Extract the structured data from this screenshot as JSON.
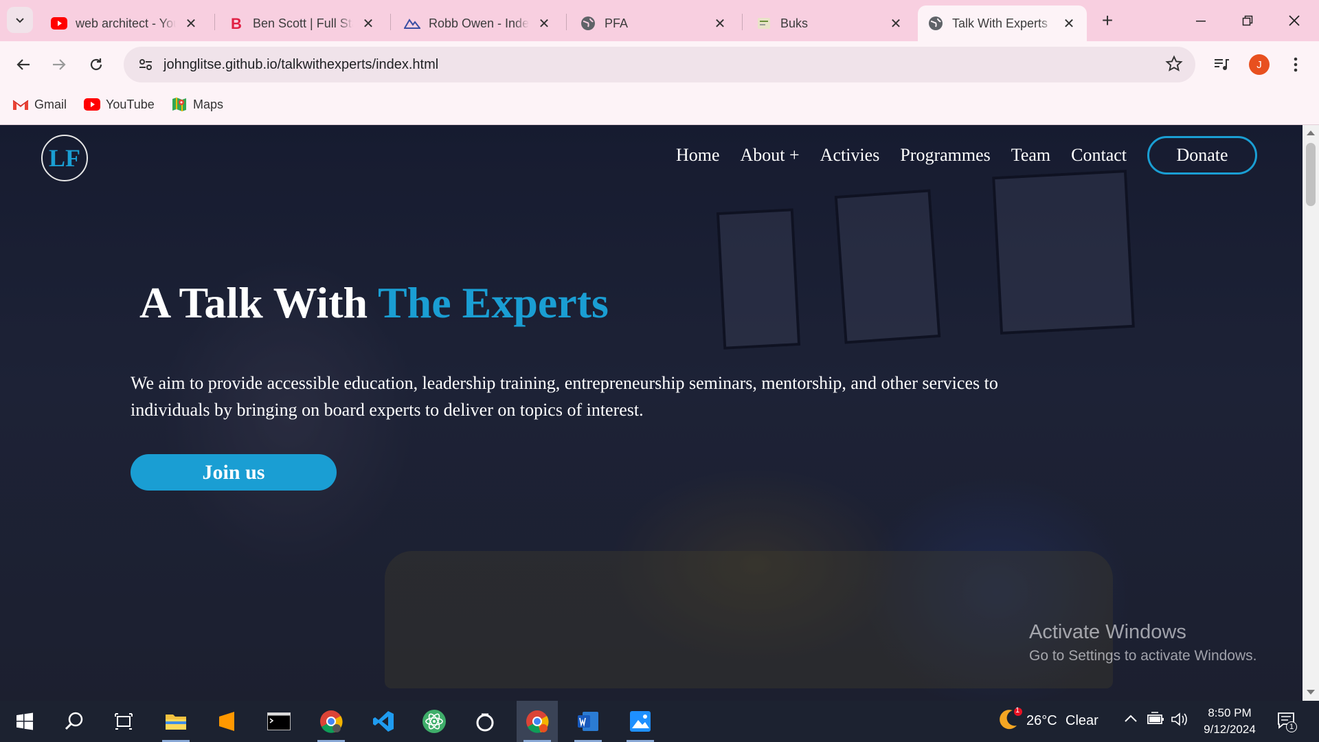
{
  "browser": {
    "tabs": [
      {
        "title": "web architect - YouTube",
        "icon": "youtube-icon",
        "active": false
      },
      {
        "title": "Ben Scott | Full Stack",
        "icon": "letter-b-icon",
        "active": false
      },
      {
        "title": "Robb Owen - Independent",
        "icon": "mountain-icon",
        "active": false
      },
      {
        "title": "PFA",
        "icon": "globe-icon",
        "active": false
      },
      {
        "title": "Buks",
        "icon": "buks-icon",
        "active": false
      },
      {
        "title": "Talk With Experts",
        "icon": "globe-icon",
        "active": true
      }
    ],
    "url": "johnglitse.github.io/talkwithexperts/index.html",
    "profile_initial": "J",
    "bookmarks": [
      {
        "label": "Gmail",
        "icon": "gmail-icon"
      },
      {
        "label": "YouTube",
        "icon": "youtube-icon"
      },
      {
        "label": "Maps",
        "icon": "maps-icon"
      }
    ]
  },
  "site": {
    "logo": "LF",
    "nav": {
      "home": "Home",
      "about": "About +",
      "activities": "Activies",
      "programmes": "Programmes",
      "team": "Team",
      "contact": "Contact",
      "donate": "Donate"
    },
    "hero": {
      "title_main": "A Talk With",
      "title_accent": "The Experts",
      "text": "We aim to provide accessible education, leadership training, entrepreneurship seminars, mentorship, and other services to individuals by bringing on board experts to deliver on topics of interest.",
      "cta": "Join us"
    },
    "colors": {
      "accent": "#1a9ed3",
      "overlay": "#1b2236"
    }
  },
  "watermark": {
    "title": "Activate Windows",
    "subtitle": "Go to Settings to activate Windows."
  },
  "taskbar": {
    "weather": {
      "temp": "26°C",
      "condition": "Clear",
      "badge": "1"
    },
    "time": "8:50 PM",
    "date": "9/12/2024",
    "notifications": "1"
  }
}
